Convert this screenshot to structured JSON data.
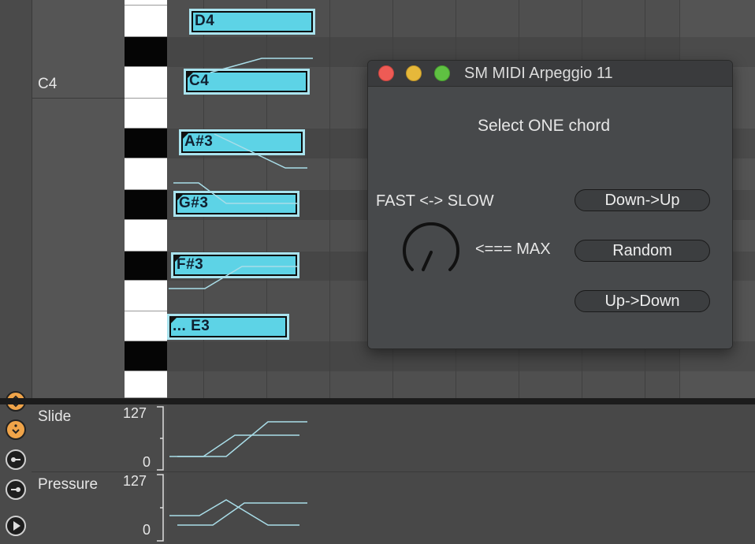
{
  "editor": {
    "pitch_label": "C4",
    "notes": [
      {
        "label": "D4"
      },
      {
        "label": "C4"
      },
      {
        "label": "A#3"
      },
      {
        "label": "G#3"
      },
      {
        "label": "F#3"
      },
      {
        "label": "... E3"
      }
    ],
    "note_color": "#5dd3e6"
  },
  "automation": {
    "lanes": [
      {
        "name": "Slide",
        "max": "127",
        "min": "0"
      },
      {
        "name": "Pressure",
        "max": "127",
        "min": "0"
      }
    ]
  },
  "side_buttons": [
    {
      "icon": "fold-expand-icon"
    },
    {
      "icon": "fold-down-icon"
    },
    {
      "icon": "slider-left-icon"
    },
    {
      "icon": "slider-right-icon"
    },
    {
      "icon": "play-icon"
    }
  ],
  "dialog": {
    "title": "SM MIDI Arpeggio 11",
    "prompt": "Select ONE chord",
    "speed_label": "FAST <-> SLOW",
    "max_label": "<=== MAX",
    "buttons": {
      "down_up": "Down->Up",
      "random": "Random",
      "up_down": "Up->Down"
    },
    "traffic_colors": {
      "close": "#ee5b55",
      "minimize": "#e6b83a",
      "zoom": "#5fc142"
    }
  }
}
